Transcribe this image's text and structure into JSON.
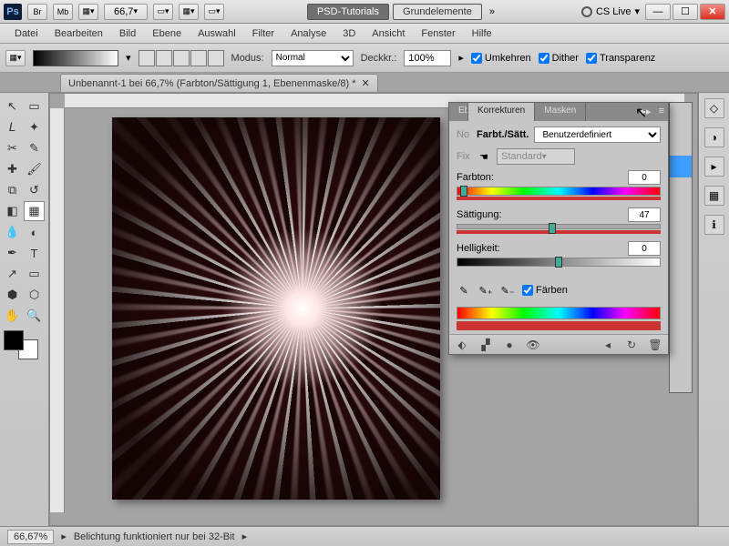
{
  "title": {
    "psd_tab": "PSD-Tutorials",
    "grund": "Grundelemente",
    "cslive": "CS Live",
    "zoom": "66,7"
  },
  "tb_icons": {
    "br": "Br",
    "mb": "Mb"
  },
  "menu": [
    "Datei",
    "Bearbeiten",
    "Bild",
    "Ebene",
    "Auswahl",
    "Filter",
    "Analyse",
    "3D",
    "Ansicht",
    "Fenster",
    "Hilfe"
  ],
  "opts": {
    "modus_lbl": "Modus:",
    "modus_val": "Normal",
    "deck_lbl": "Deckkr.:",
    "deck_val": "100%",
    "umkehren": "Umkehren",
    "dither": "Dither",
    "transp": "Transparenz"
  },
  "doc_tab": "Unbenannt-1 bei 66,7% (Farbton/Sättigung 1, Ebenenmaske/8) *",
  "panel": {
    "tabs": {
      "eb": "Eb",
      "korr": "Korrekturen",
      "masken": "Masken"
    },
    "title": "Farbt./Sätt.",
    "preset": "Benutzerdefiniert",
    "no": "No",
    "fix": "Fix",
    "chan": "Standard",
    "hue_lbl": "Farbton:",
    "hue_val": "0",
    "sat_lbl": "Sättigung:",
    "sat_val": "47",
    "lit_lbl": "Helligkeit:",
    "lit_val": "0",
    "colorize": "Färben"
  },
  "status": {
    "zoom": "66,67%",
    "msg": "Belichtung funktioniert nur bei 32-Bit"
  }
}
